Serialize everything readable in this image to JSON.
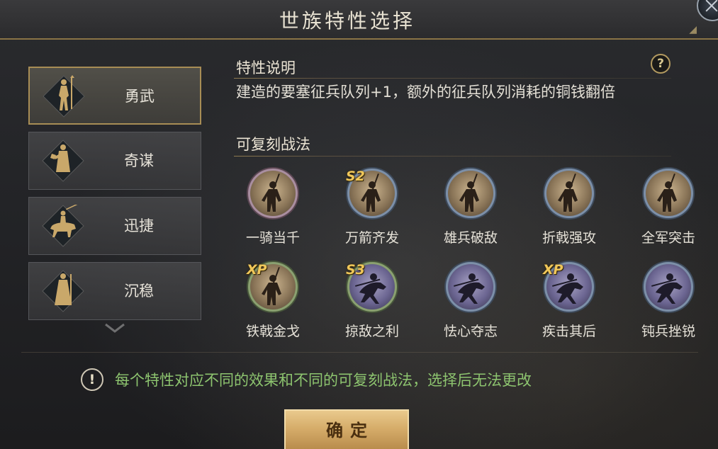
{
  "window": {
    "title": "世族特性选择"
  },
  "traits": [
    {
      "label": "勇武",
      "icon": "warrior-figure-icon",
      "selected": true
    },
    {
      "label": "奇谋",
      "icon": "strategist-figure-icon",
      "selected": false
    },
    {
      "label": "迅捷",
      "icon": "cavalry-figure-icon",
      "selected": false
    },
    {
      "label": "沉稳",
      "icon": "guardian-figure-icon",
      "selected": false
    }
  ],
  "description": {
    "title": "特性说明",
    "text": "建造的要塞征兵队列+1，额外的征兵队列消耗的铜钱翻倍"
  },
  "skills_section": {
    "title": "可复刻战法"
  },
  "skills": [
    {
      "name": "一骑当千",
      "badge": "",
      "ring": "pink",
      "tone": "warm"
    },
    {
      "name": "万箭齐发",
      "badge": "S2",
      "ring": "blue",
      "tone": "warm"
    },
    {
      "name": "雄兵破敌",
      "badge": "",
      "ring": "blue",
      "tone": "warm"
    },
    {
      "name": "折戟强攻",
      "badge": "",
      "ring": "blue",
      "tone": "warm"
    },
    {
      "name": "全军突击",
      "badge": "",
      "ring": "blue",
      "tone": "warm"
    },
    {
      "name": "铁戟金戈",
      "badge": "XP",
      "ring": "green",
      "tone": "warm"
    },
    {
      "name": "掠敌之利",
      "badge": "S3",
      "ring": "green",
      "tone": "cool"
    },
    {
      "name": "怯心夺志",
      "badge": "",
      "ring": "blue",
      "tone": "cool"
    },
    {
      "name": "疾击其后",
      "badge": "XP",
      "ring": "blue",
      "tone": "cool"
    },
    {
      "name": "钝兵挫锐",
      "badge": "",
      "ring": "blue",
      "tone": "cool"
    }
  ],
  "help_label": "?",
  "notice": {
    "icon_label": "!",
    "text": "每个特性对应不同的效果和不同的可复刻战法，选择后无法更改",
    "color": "#8dc46f"
  },
  "confirm_label": "确定",
  "colors": {
    "accent_gold": "#a88d55",
    "badge_gold": "#f0c75a"
  }
}
